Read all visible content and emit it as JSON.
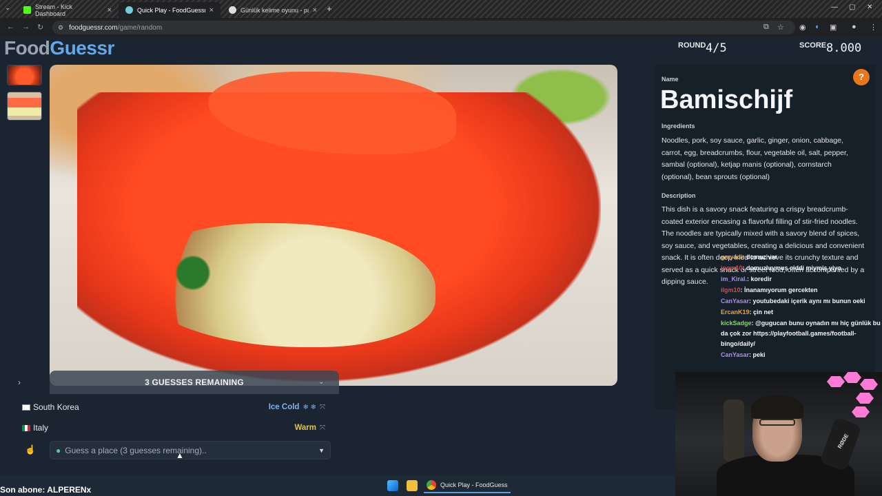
{
  "browser": {
    "tabs": [
      {
        "title": "Stream - Kick Dashboard",
        "favicon_color": "#53fc18",
        "active": false
      },
      {
        "title": "Quick Play - FoodGuessr | Food",
        "favicon_color": "#6fd0d8",
        "active": true
      },
      {
        "title": "Günlük kelime oyunu - parolla",
        "favicon_color": "#dddddd",
        "active": false
      }
    ],
    "new_tab_icon": "+",
    "url_domain": "foodguessr.com",
    "url_path": "/game/random"
  },
  "header": {
    "logo_part1": "Food",
    "logo_part2": "Guessr",
    "round_label": "ROUND",
    "round_value": "4/5",
    "score_label": "SCORE",
    "score_value": "8.000"
  },
  "guesses": {
    "remaining_label": "3 GUESSES REMAINING",
    "items": [
      {
        "country": "South Korea",
        "status": "Ice Cold",
        "status_color": "#7db3ee",
        "icon": "❄ ❄"
      },
      {
        "country": "Italy",
        "status": "Warm",
        "status_color": "#e0c24a",
        "icon": ""
      }
    ],
    "input_placeholder": "Guess a place (3 guesses remaining).."
  },
  "info": {
    "name_label": "Name",
    "dish_name": "Bamischijf",
    "ingredients_label": "Ingredients",
    "ingredients": "Noodles, pork, soy sauce, garlic, ginger, onion, cabbage, carrot, egg, breadcrumbs, flour, vegetable oil, salt, pepper, sambal (optional), ketjap manis (optional), cornstarch (optional), bean sprouts (optional)",
    "description_label": "Description",
    "description": "This dish is a savory snack featuring a crispy breadcrumb-coated exterior encasing a flavorful filling of stir-fried noodles. The noodles are typically mixed with a savory blend of spices, soy sauce, and vegetables, creating a delicious and convenient snack. It is often deep-fried to achieve its crunchy texture and served as a quick snack or street food, often accompanied by a dipping sauce."
  },
  "chat": [
    {
      "user": "im_Kiral.",
      "color": "#b18cf0",
      "text": ": koredir"
    },
    {
      "user": "ilgm10",
      "color": "#e04848",
      "text": ": İnanamıyorum gercekten"
    },
    {
      "user": "CanYasar",
      "color": "#b18cf0",
      "text": ": youtubedaki içerik aynı mı bunun oeki"
    },
    {
      "user": "ErcanK19",
      "color": "#e8a33a",
      "text": ": çin net"
    },
    {
      "user": "kickSadge",
      "color": "#7ce05a",
      "text": ": @gugucan bunu oynadın mı hiç günlük bu da çok zor https://playfootball.games/football-bingo/daily/"
    },
    {
      "user": "CanYasar",
      "color": "#b18cf0",
      "text": ": peki"
    }
  ],
  "chat_overlap": [
    {
      "user": "gmyadi",
      "color": "#e8a33a",
      "text": ": domuz var"
    },
    {
      "user": "ipgm10",
      "color": "#e04848",
      "text": ": domuzluymuş ciddi miymiş yiyo"
    }
  ],
  "stream": {
    "last_sub": "Son abone: ALPERENx",
    "mic_brand": "RØDE"
  },
  "taskbar": {
    "app_label": "Quick Play - FoodGuess"
  }
}
